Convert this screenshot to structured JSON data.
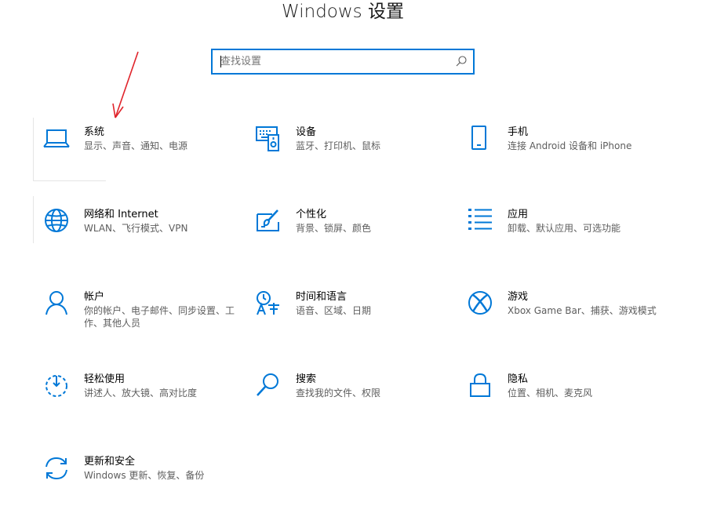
{
  "window": {
    "title": "Windows 设置"
  },
  "search": {
    "placeholder": "查找设置",
    "icon": "search-icon"
  },
  "colors": {
    "accent": "#0078d7",
    "annotation_arrow": "#e0242b"
  },
  "categories": [
    {
      "id": "system",
      "icon": "laptop-icon",
      "name": "系统",
      "description": "显示、声音、通知、电源"
    },
    {
      "id": "devices",
      "icon": "devices-icon",
      "name": "设备",
      "description": "蓝牙、打印机、鼠标"
    },
    {
      "id": "phone",
      "icon": "phone-icon",
      "name": "手机",
      "description": "连接 Android 设备和 iPhone"
    },
    {
      "id": "network",
      "icon": "globe-icon",
      "name": "网络和 Internet",
      "description": "WLAN、飞行模式、VPN"
    },
    {
      "id": "personalization",
      "icon": "paint-icon",
      "name": "个性化",
      "description": "背景、锁屏、颜色"
    },
    {
      "id": "apps",
      "icon": "apps-list-icon",
      "name": "应用",
      "description": "卸载、默认应用、可选功能"
    },
    {
      "id": "accounts",
      "icon": "person-icon",
      "name": "帐户",
      "description": "你的帐户、电子邮件、同步设置、工作、其他人员"
    },
    {
      "id": "time-language",
      "icon": "time-language-icon",
      "name": "时间和语言",
      "description": "语音、区域、日期"
    },
    {
      "id": "gaming",
      "icon": "xbox-icon",
      "name": "游戏",
      "description": "Xbox Game Bar、捕获、游戏模式"
    },
    {
      "id": "ease-of-access",
      "icon": "ease-of-access-icon",
      "name": "轻松使用",
      "description": "讲述人、放大镜、高对比度"
    },
    {
      "id": "search",
      "icon": "magnifier-icon",
      "name": "搜索",
      "description": "查找我的文件、权限"
    },
    {
      "id": "privacy",
      "icon": "lock-icon",
      "name": "隐私",
      "description": "位置、相机、麦克风"
    },
    {
      "id": "update-security",
      "icon": "sync-icon",
      "name": "更新和安全",
      "description": "Windows 更新、恢复、备份"
    }
  ]
}
